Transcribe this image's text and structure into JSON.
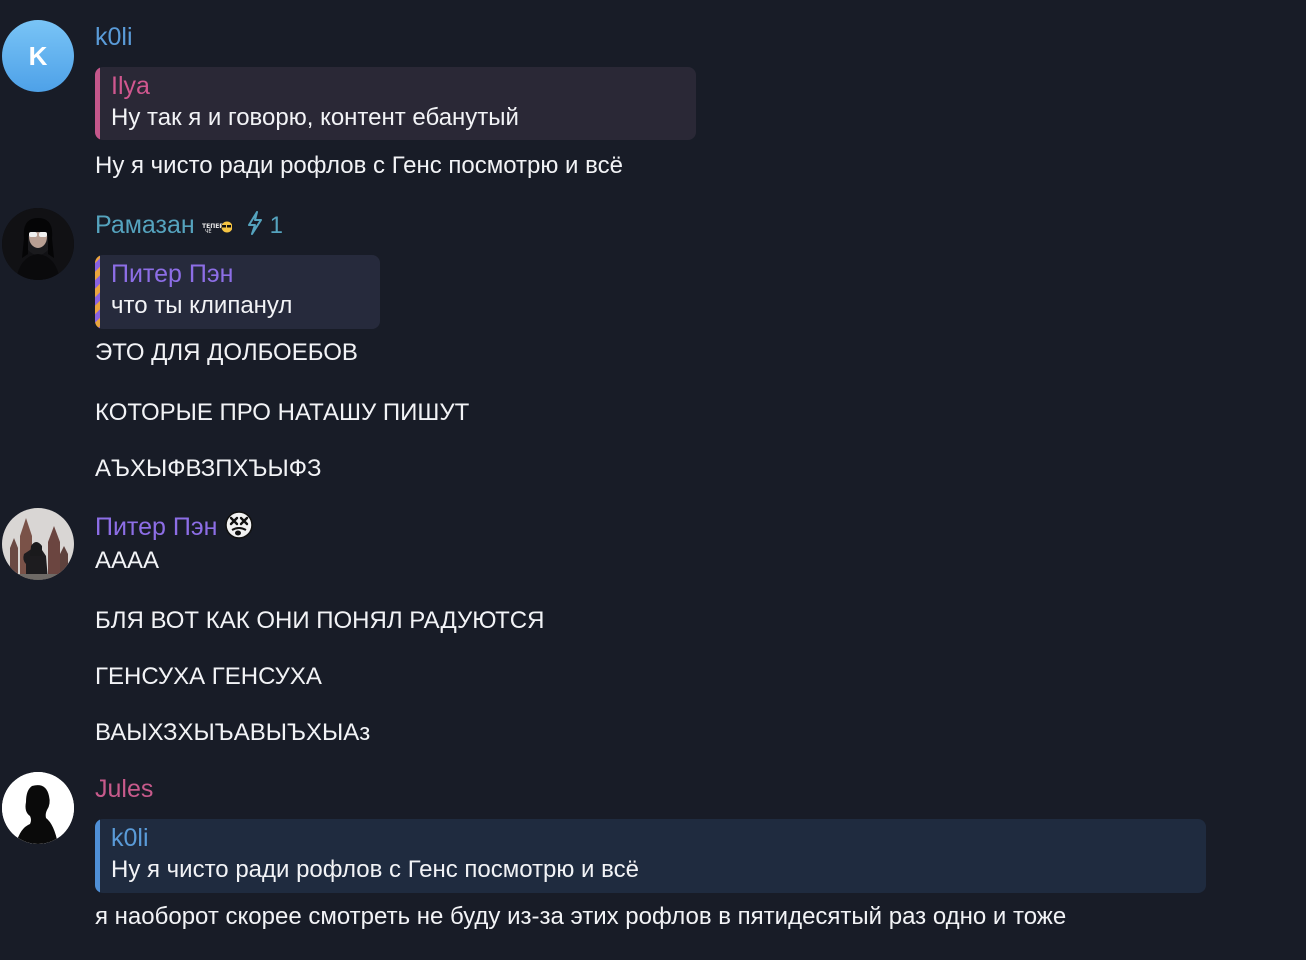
{
  "colors": {
    "background": "#181c27",
    "koli_name": "#5a9bd8",
    "ilya_name": "#d0578f",
    "ramazan_name": "#55a3be",
    "piter_name": "#8d6ee6",
    "jules_name": "#c75a8b",
    "boost": "#55a3be"
  },
  "messages": [
    {
      "author": "k0li",
      "avatar_letter": "K",
      "reply": {
        "name": "Ilya",
        "text": "Ну так я и говорю, контент ебанутый"
      },
      "lines": [
        "Ну я чисто ради рофлов с Генс посмотрю и всё"
      ]
    },
    {
      "author": "Рамазан",
      "boost_icon": "lightning-icon",
      "boost_count": "1",
      "reply": {
        "name": "Питер Пэн",
        "text": "что ты клипанул"
      },
      "lines": [
        "ЭТО ДЛЯ ДОЛБОЕБОВ",
        "КОТОРЫЕ ПРО НАТАШУ ПИШУТ",
        "АЪХЫФВЗПХЪЫФЗ"
      ]
    },
    {
      "author": "Питер Пэн",
      "status_icon": "dizzy-face-emoji-icon",
      "lines": [
        "АААА",
        "БЛЯ ВОТ КАК ОНИ ПОНЯЛ РАДУЮТСЯ",
        "ГЕНСУХА ГЕНСУХА",
        "ВАЫХЗХЫЪАВЫЪХЫАз"
      ]
    },
    {
      "author": "Jules",
      "reply": {
        "name": "k0li",
        "text": "Ну я чисто ради рофлов с Генс посмотрю и всё"
      },
      "lines": [
        "я наоборот скорее смотреть не буду из-за этих рофлов в пятидесятый раз одно и тоже"
      ]
    }
  ]
}
